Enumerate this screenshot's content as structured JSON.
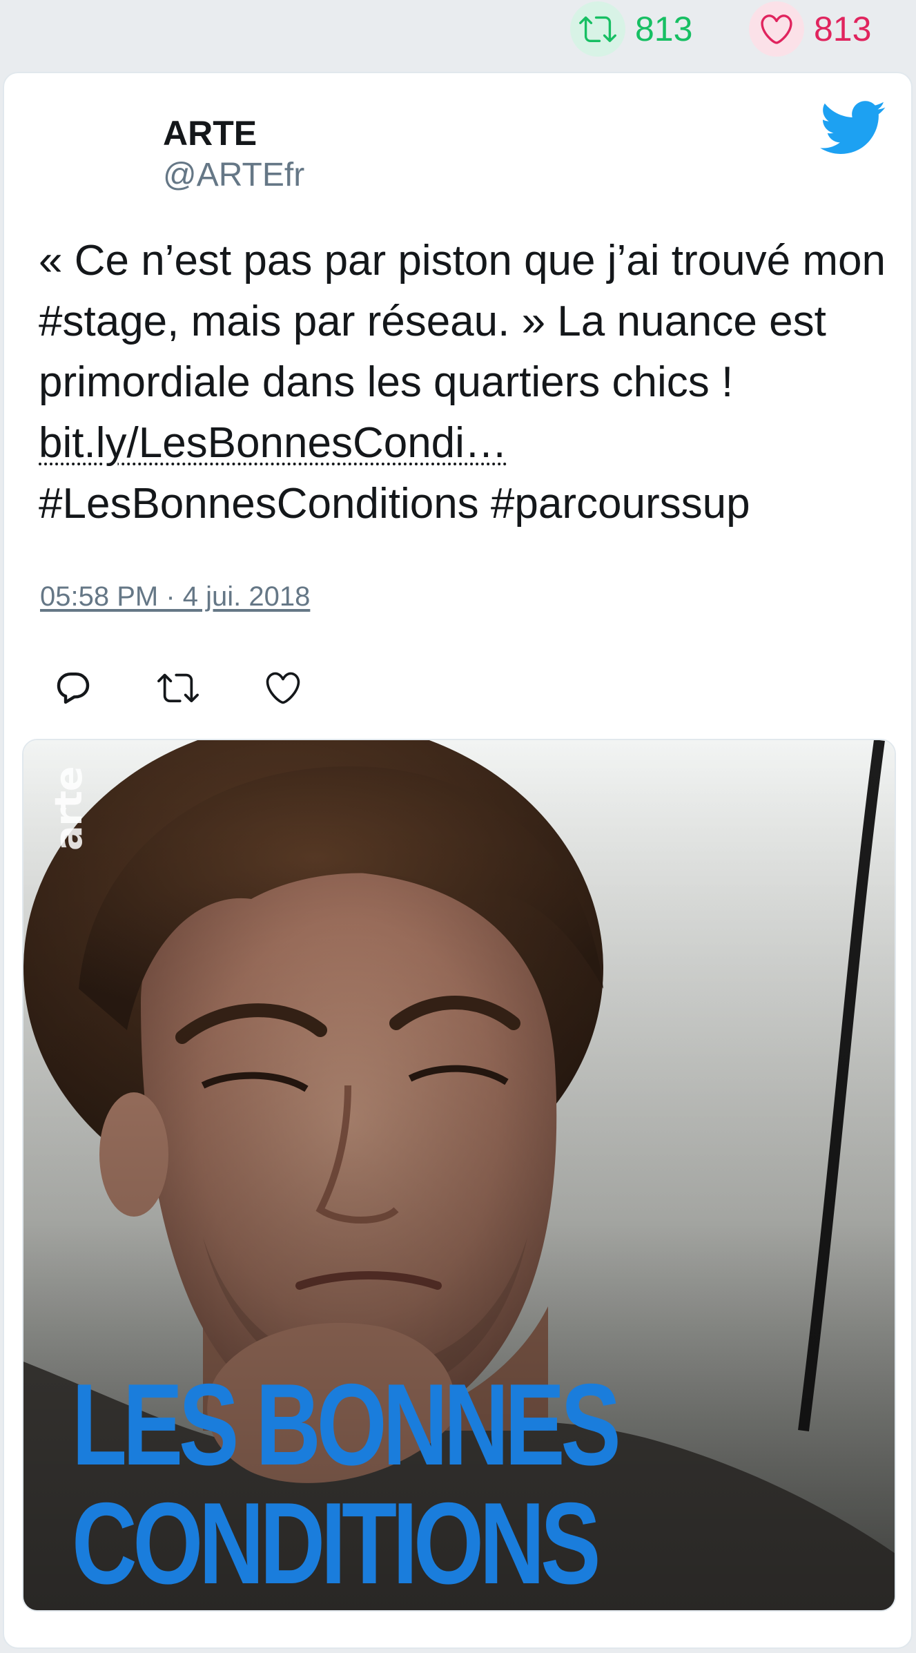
{
  "stats": {
    "retweets": "813",
    "likes": "813",
    "retweet_icon": "retweet-icon",
    "like_icon": "heart-icon",
    "retweet_color": "#17bf63",
    "like_color": "#e0245e"
  },
  "tweet": {
    "author_name": "ARTE",
    "author_handle": "@ARTEfr",
    "text_part1": "« Ce n’est pas par piston que j’ai trouvé mon #stage, mais par réseau. » La nuance est primordiale dans les quartiers chics ! ",
    "link": "bit.ly/LesBonnesCondi…",
    "text_part2": "#LesBonnesConditions #parcourssup",
    "timestamp": "05:58 PM · 4 jui. 2018",
    "brand_icon": "twitter-bird-icon",
    "brand_color": "#1da1f2"
  },
  "actions": {
    "reply_icon": "reply-icon",
    "retweet_icon": "retweet-icon",
    "like_icon": "heart-icon"
  },
  "media": {
    "channel_logo": "arte",
    "title_line1": "LES BONNES",
    "title_line2": "CONDITIONS",
    "title_color": "#1a7ddc"
  }
}
